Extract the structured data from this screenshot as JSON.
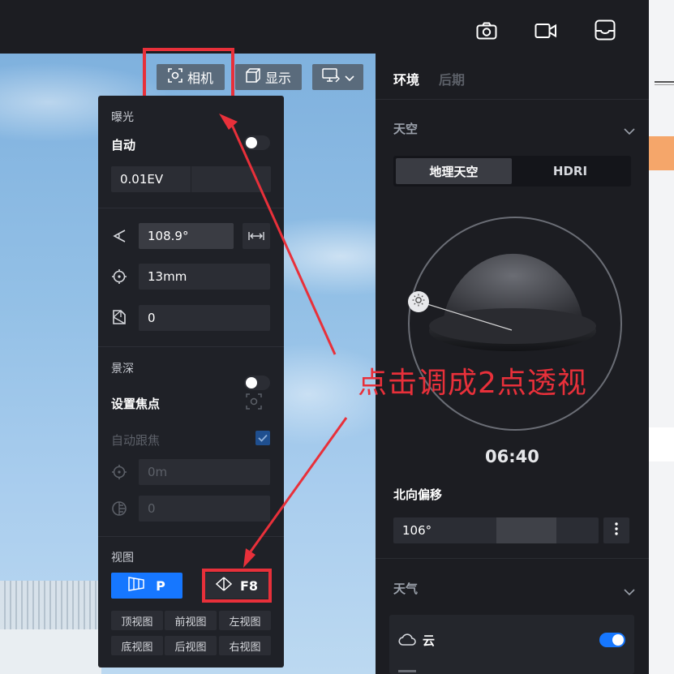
{
  "topbar": {
    "icons": [
      "camera-icon",
      "video-icon",
      "inbox-icon"
    ]
  },
  "viewport_toolbar": {
    "camera_label": "相机",
    "display_label": "显示",
    "view_dropdown_icon": "monitor-icon"
  },
  "camera_panel": {
    "exposure": {
      "title": "曝光",
      "auto_label": "自动",
      "auto_on": false,
      "ev_value": "0.01EV"
    },
    "fov_value": "108.9°",
    "focal_value": "13mm",
    "shift_value": "0",
    "dof": {
      "title": "景深",
      "on": false,
      "set_focus_label": "设置焦点",
      "auto_focus_label": "自动跟焦",
      "focus_distance": "0m",
      "aperture": "0"
    },
    "view": {
      "title": "视图",
      "perspective_label": "P",
      "two_point_label": "F8",
      "presets": [
        "顶视图",
        "前视图",
        "左视图",
        "底视图",
        "后视图",
        "右视图"
      ]
    }
  },
  "annotation": {
    "text": "点击调成2点透视",
    "color": "#e8303a"
  },
  "right_panel": {
    "tabs": [
      "环境",
      "后期"
    ],
    "sky": {
      "title": "天空",
      "segments": [
        "地理天空",
        "HDRI"
      ],
      "time": "06:40",
      "north_offset_label": "北向偏移",
      "north_offset_value": "106°"
    },
    "weather": {
      "title": "天气",
      "cloud_label": "云",
      "cloud_on": true
    }
  },
  "colors": {
    "accent_blue": "#1677ff",
    "panel_bg": "#1f2127",
    "highlight_red": "#e8303a"
  }
}
